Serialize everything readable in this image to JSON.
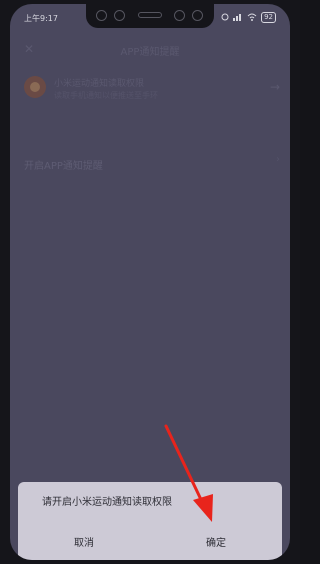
{
  "status_bar": {
    "time": "上午9:17",
    "battery": "92"
  },
  "header": {
    "title": "APP通知提醒"
  },
  "app_card": {
    "line1": "小米运动通知读取权限",
    "line2": "读取手机通知以便推送至手环"
  },
  "setting": {
    "label": "开启APP通知提醒"
  },
  "dialog": {
    "message": "请开启小米运动通知读取权限",
    "cancel_label": "取消",
    "confirm_label": "确定"
  },
  "colors": {
    "overlay": "#4a485e",
    "dialog_bg": "#cdcad6",
    "annotation_arrow": "#e8241c"
  }
}
